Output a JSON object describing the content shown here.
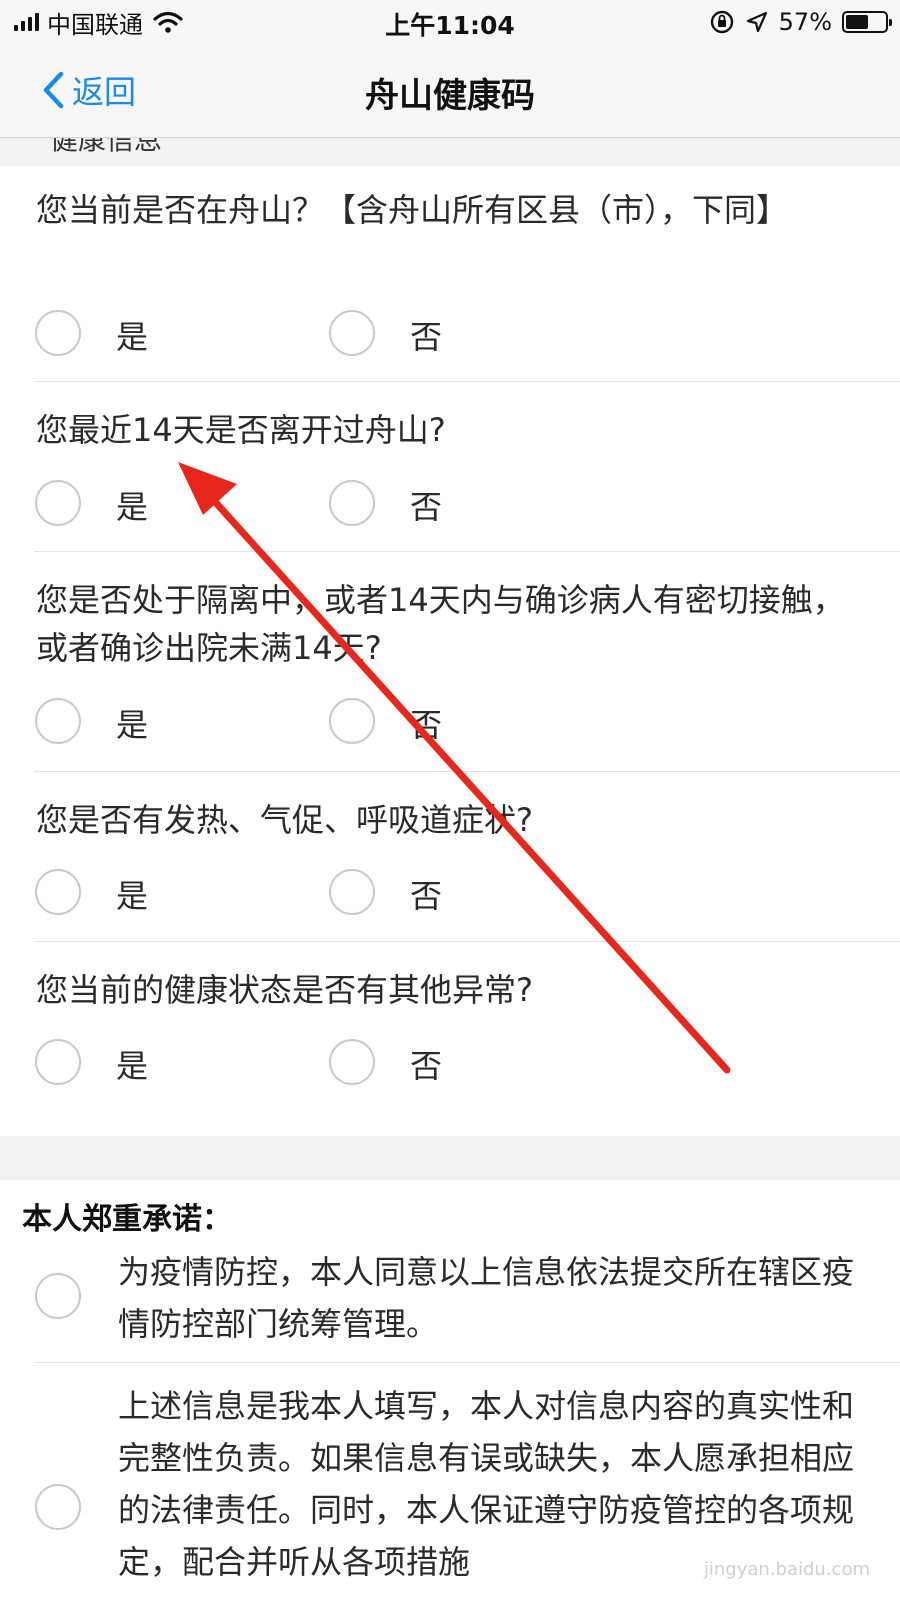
{
  "status_bar": {
    "carrier": "中国联通",
    "time": "上午11:04",
    "battery_percent": "57%",
    "battery_level": 0.57
  },
  "nav": {
    "back_label": "返回",
    "title": "舟山健康码"
  },
  "section_peek_label": "健康信息",
  "questions": [
    {
      "text": "您当前是否在舟山？【含舟山所有区县（市），下同】",
      "yes": "是",
      "no": "否"
    },
    {
      "text": "您最近14天是否离开过舟山?",
      "yes": "是",
      "no": "否"
    },
    {
      "text": "您是否处于隔离中，或者14天内与确诊病人有密切接触，或者确诊出院未满14天?",
      "yes": "是",
      "no": "否"
    },
    {
      "text": "您是否有发热、气促、呼吸道症状?",
      "yes": "是",
      "no": "否"
    },
    {
      "text": "您当前的健康状态是否有其他异常?",
      "yes": "是",
      "no": "否"
    }
  ],
  "pledge": {
    "heading": "本人郑重承诺：",
    "items": [
      {
        "text": "为疫情防控，本人同意以上信息依法提交所在辖区疫情防控部门统筹管理。"
      },
      {
        "text": "上述信息是我本人填写，本人对信息内容的真实性和完整性负责。如果信息有误或缺失，本人愿承担相应的法律责任。同时，本人保证遵守防疫管控的各项规定，配合并听从各项措施"
      }
    ]
  },
  "watermark": "jingyan.baidu.com",
  "colors": {
    "accent_blue": "#1a8be8",
    "annotation_red": "#e8261c",
    "radio_border": "#c9c9c9"
  }
}
